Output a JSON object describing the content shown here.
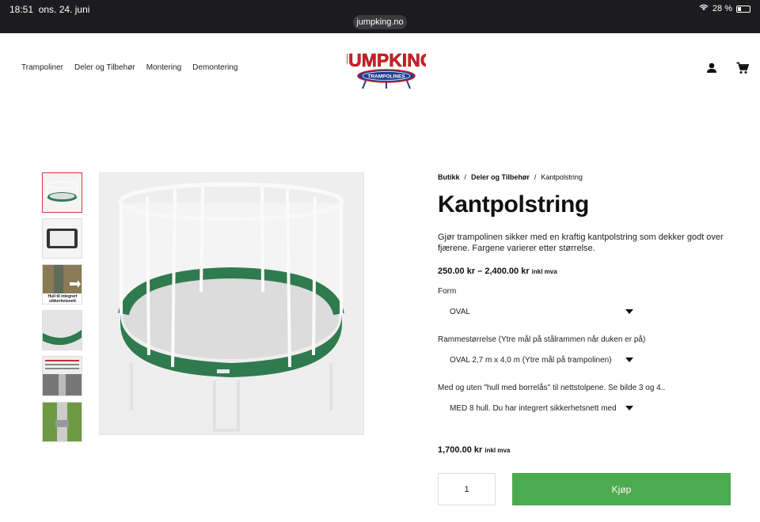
{
  "status_bar": {
    "time": "18:51",
    "date": "ons. 24. juni",
    "url": "jumpking.no",
    "battery": "28 %"
  },
  "nav": [
    "Trampoliner",
    "Deler og Tilbehør",
    "Montering",
    "Demontering"
  ],
  "logo": {
    "brand": "JUMPKING",
    "sub": "TRAMPOLINES"
  },
  "breadcrumb": {
    "home": "Butikk",
    "sep": "/",
    "category": "Deler og Tilbehør",
    "current": "Kantpolstring"
  },
  "product": {
    "title": "Kantpolstring",
    "description": "Gjør trampolinen sikker med en kraftig kantpolstring som dekker godt over fjærene. Fargene varierer etter størrelse.",
    "price_range": "250.00 kr – 2,400.00 kr",
    "vat_note": "inkl mva",
    "form_label": "Form",
    "form_value": "OVAL",
    "size_label": "Rammestørrelse (Ytre mål på stålrammen når duken er på)",
    "size_value": "OVAL 2,7 m x 4,0 m (Ytre mål på trampolinen)",
    "holes_label": "Med og uten \"hull med borrelås\" til nettstolpene. Se bilde 3 og 4..",
    "holes_value": "MED 8 hull. Du har integrert sikkerhetsnett med",
    "selected_price": "1,700.00 kr",
    "quantity": "1",
    "buy_label": "Kjøp"
  },
  "thumbnail_caption": "Hull til integrert sikkerhetsnett",
  "colors": {
    "buy": "#4caa4f",
    "pad": "#2f7a4f",
    "logo_red": "#d42026",
    "logo_blue": "#1f3f8f"
  }
}
